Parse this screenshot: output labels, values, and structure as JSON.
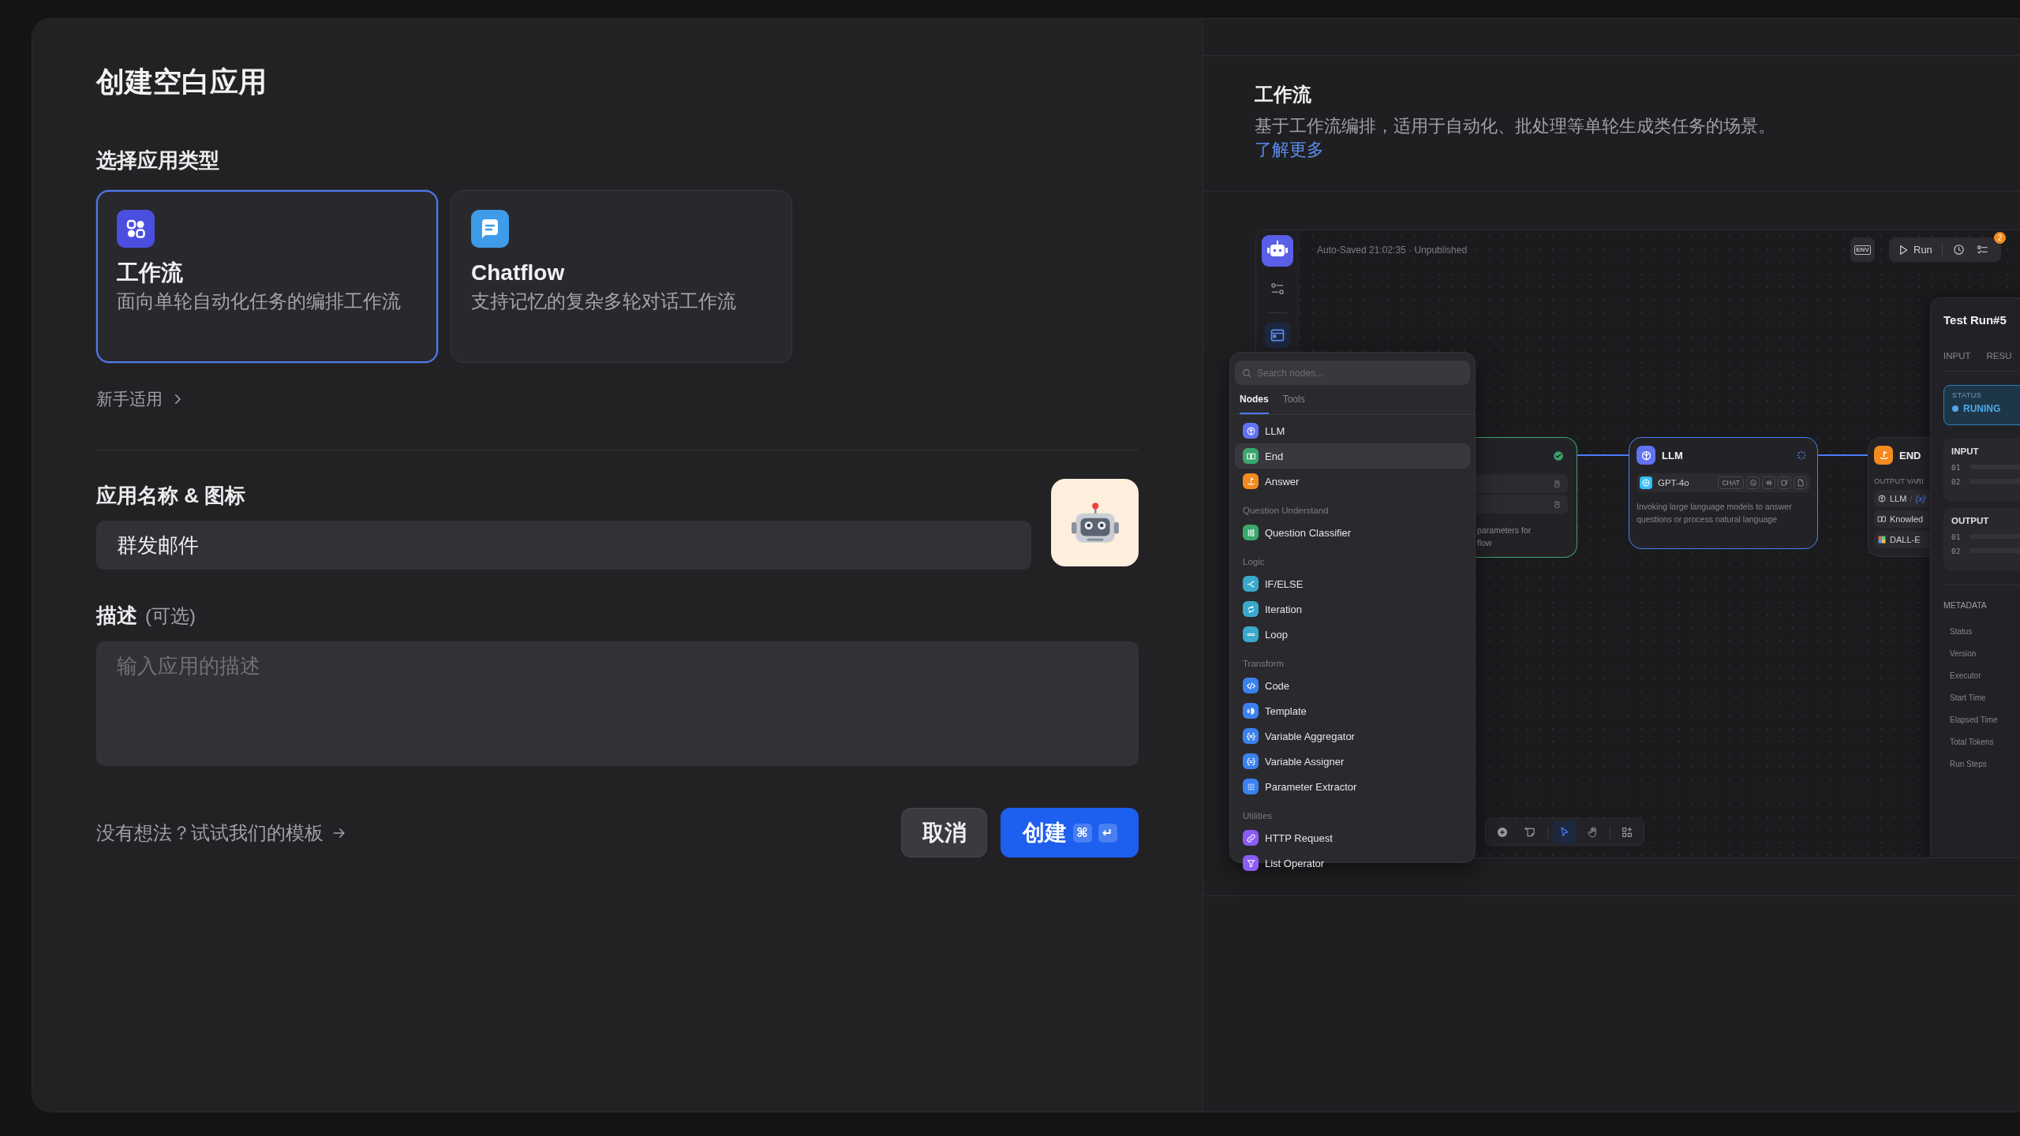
{
  "dialog": {
    "title": "创建空白应用"
  },
  "app_type": {
    "label": "选择应用类型",
    "options": [
      {
        "kind": "workflow",
        "title": "工作流",
        "description": "面向单轮自动化任务的编排工作流",
        "selected": true
      },
      {
        "kind": "chatflow",
        "title": "Chatflow",
        "description": "支持记忆的复杂多轮对话工作流",
        "selected": false
      }
    ],
    "beginner_link": "新手适用"
  },
  "name_field": {
    "label": "应用名称 & 图标",
    "value": "群发邮件"
  },
  "description_field": {
    "label": "描述",
    "hint": "(可选)",
    "placeholder": "输入应用的描述"
  },
  "template_link": "没有想法？试试我们的模板",
  "buttons": [
    {
      "kind": "secondary",
      "label": "取消"
    },
    {
      "kind": "primary",
      "label": "创建",
      "keys": [
        "⌘",
        "↵"
      ]
    }
  ],
  "preview": {
    "title": "工作流",
    "description": "基于工作流编排，适用于自动化、批处理等单轮生成类任务的场景。",
    "learn_more": "了解更多",
    "editor": {
      "autosave": "Auto-Saved 21:02:35 · Unpublished",
      "env": "ENV",
      "run": "Run",
      "checklist_badge": "2",
      "sidebar_tabs": [
        {
          "kind": "settings",
          "selected": false
        },
        {
          "kind": "window",
          "selected": true
        }
      ],
      "node_picker": {
        "search_placeholder": "Search nodes...",
        "tabs": [
          {
            "label": "Nodes",
            "selected": true
          },
          {
            "label": "Tools",
            "selected": false
          }
        ],
        "groups": [
          {
            "items": [
              {
                "kind": "llm",
                "label": "LLM",
                "color": "#6172f3",
                "selected": false
              },
              {
                "kind": "end",
                "label": "End",
                "color": "#3aa76d",
                "selected": true
              },
              {
                "kind": "answer",
                "label": "Answer",
                "color": "#f38b1f",
                "selected": false
              }
            ]
          },
          {
            "title": "Question Understand",
            "items": [
              {
                "kind": "classifier",
                "label": "Question Classifier",
                "color": "#3aa76d",
                "selected": false
              }
            ]
          },
          {
            "title": "Logic",
            "items": [
              {
                "kind": "ifelse",
                "label": "IF/ELSE",
                "color": "#3aa9cc",
                "selected": false
              },
              {
                "kind": "iteration",
                "label": "Iteration",
                "color": "#3aa9cc",
                "selected": false
              },
              {
                "kind": "loop",
                "label": "Loop",
                "color": "#3aa9cc",
                "selected": false
              }
            ]
          },
          {
            "title": "Transform",
            "items": [
              {
                "kind": "code",
                "label": "Code",
                "color": "#3b82f0",
                "selected": false
              },
              {
                "kind": "template",
                "label": "Template",
                "color": "#3b82f0",
                "selected": false
              },
              {
                "kind": "aggregator",
                "label": "Variable Aggregator",
                "color": "#3b82f0",
                "selected": false
              },
              {
                "kind": "assigner",
                "label": "Variable Assigner",
                "color": "#3b82f0",
                "selected": false
              },
              {
                "kind": "extractor",
                "label": "Parameter Extractor",
                "color": "#3b82f0",
                "selected": false
              }
            ]
          },
          {
            "title": "Utilities",
            "items": [
              {
                "kind": "http",
                "label": "HTTP Request",
                "color": "#8b5cf6",
                "selected": false
              },
              {
                "kind": "list",
                "label": "List Operator",
                "color": "#8b5cf6",
                "selected": false
              }
            ]
          }
        ]
      },
      "nodes": [
        {
          "kind": "start",
          "succeeded": true,
          "description_lines": [
            "parameters for",
            "flow"
          ]
        },
        {
          "kind": "llm",
          "title": "LLM",
          "running": true,
          "model": "GPT-4o",
          "mode": "CHAT",
          "description": "Invoking large language models to answer questions or process natural language"
        },
        {
          "kind": "end",
          "title": "END",
          "outputs_label": "OUTPUT VARI",
          "outputs": [
            {
              "kind": "llm",
              "label": "LLM",
              "separator": "/",
              "variable": "{x}"
            },
            {
              "kind": "knowledge",
              "label": "Knowled"
            },
            {
              "kind": "image",
              "label": "DALL-E"
            }
          ]
        }
      ],
      "canvas_tools": [
        {
          "kind": "add",
          "selected": false
        },
        {
          "kind": "note",
          "selected": false
        },
        {
          "kind": "pointer",
          "selected": true
        },
        {
          "kind": "hand",
          "selected": false
        },
        {
          "kind": "layout",
          "selected": false
        }
      ],
      "test_run": {
        "title": "Test Run#5",
        "tabs": [
          "INPUT",
          "RESU"
        ],
        "status_label": "STATUS",
        "status": "RUNING",
        "sections": [
          {
            "title": "INPUT",
            "rows": [
              "01",
              "02"
            ]
          },
          {
            "title": "OUTPUT",
            "rows": [
              "01",
              "02"
            ]
          }
        ],
        "metadata_title": "METADATA",
        "metadata": [
          "Status",
          "Version",
          "Executor",
          "Start Time",
          "Elapsed Time",
          "Total Tokens",
          "Run Steps"
        ]
      }
    }
  }
}
